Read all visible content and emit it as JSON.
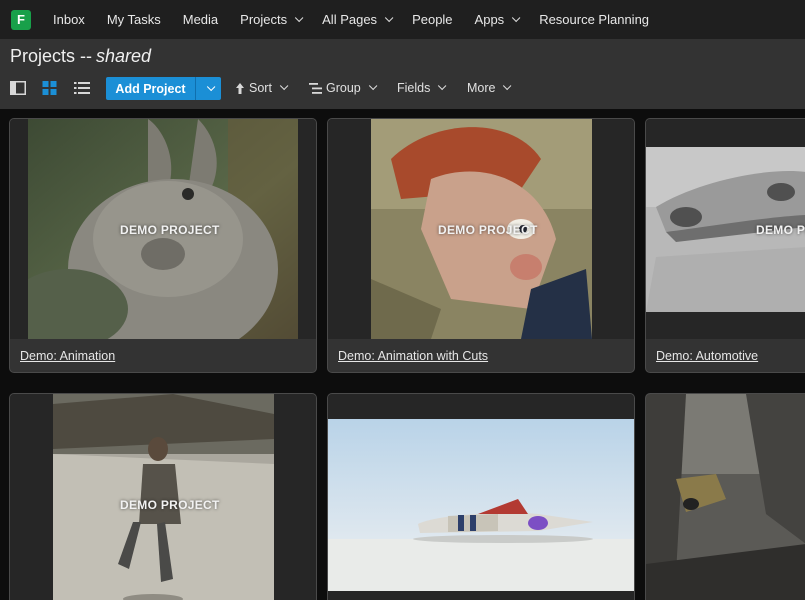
{
  "app": {
    "logo_letter": "F"
  },
  "nav": {
    "items": [
      {
        "label": "Inbox",
        "dropdown": false
      },
      {
        "label": "My Tasks",
        "dropdown": false
      },
      {
        "label": "Media",
        "dropdown": false
      },
      {
        "label": "Projects",
        "dropdown": true
      },
      {
        "label": "All Pages",
        "dropdown": true
      },
      {
        "label": "People",
        "dropdown": false
      },
      {
        "label": "Apps",
        "dropdown": true
      },
      {
        "label": "Resource Planning",
        "dropdown": false
      }
    ]
  },
  "header": {
    "title": "Projects --",
    "title_suffix": "shared"
  },
  "toolbar": {
    "add_label": "Add Project",
    "sort_label": "Sort",
    "group_label": "Group",
    "fields_label": "Fields",
    "more_label": "More",
    "accent": "#1b8fd6"
  },
  "cards": [
    {
      "title": "Demo: Animation",
      "badge": "DEMO PROJECT"
    },
    {
      "title": "Demo: Animation with Cuts",
      "badge": "DEMO PROJECT"
    },
    {
      "title": "Demo: Automotive",
      "badge": "DEMO PR"
    },
    {
      "title": "",
      "badge": "DEMO PROJECT"
    },
    {
      "title": "",
      "badge": ""
    },
    {
      "title": "",
      "badge": ""
    }
  ]
}
